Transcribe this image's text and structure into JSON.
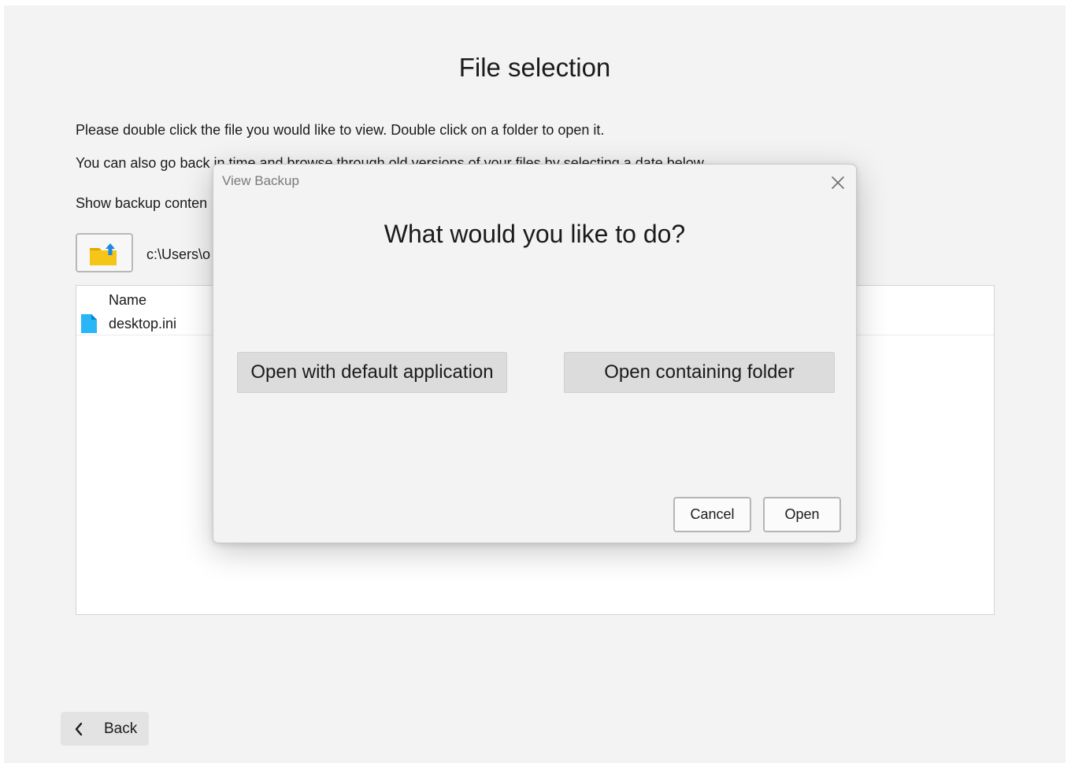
{
  "page": {
    "title": "File selection",
    "instruction_1": "Please double click the file you would like to view. Double click on a folder to open it.",
    "instruction_2": "You can also go back in time and browse through old versions of your files by selecting a date below.",
    "show_backup_label": "Show backup conten",
    "path": "c:\\Users\\o",
    "up_button_icon": "folder-up-icon",
    "back_label": "Back",
    "back_icon": "chevron-left-icon"
  },
  "file_list": {
    "column_name": "Name",
    "rows": [
      {
        "name": "desktop.ini",
        "icon": "file-icon",
        "icon_color": "#29b6f6"
      }
    ]
  },
  "dialog": {
    "title": "View Backup",
    "close_icon": "close-icon",
    "question": "What would you like to do?",
    "option_default": "Open with default application",
    "option_folder": "Open containing folder",
    "cancel_label": "Cancel",
    "open_label": "Open"
  },
  "colors": {
    "folder": "#f5c518",
    "folder_arrow": "#1e88e5",
    "file": "#29b6f6"
  }
}
